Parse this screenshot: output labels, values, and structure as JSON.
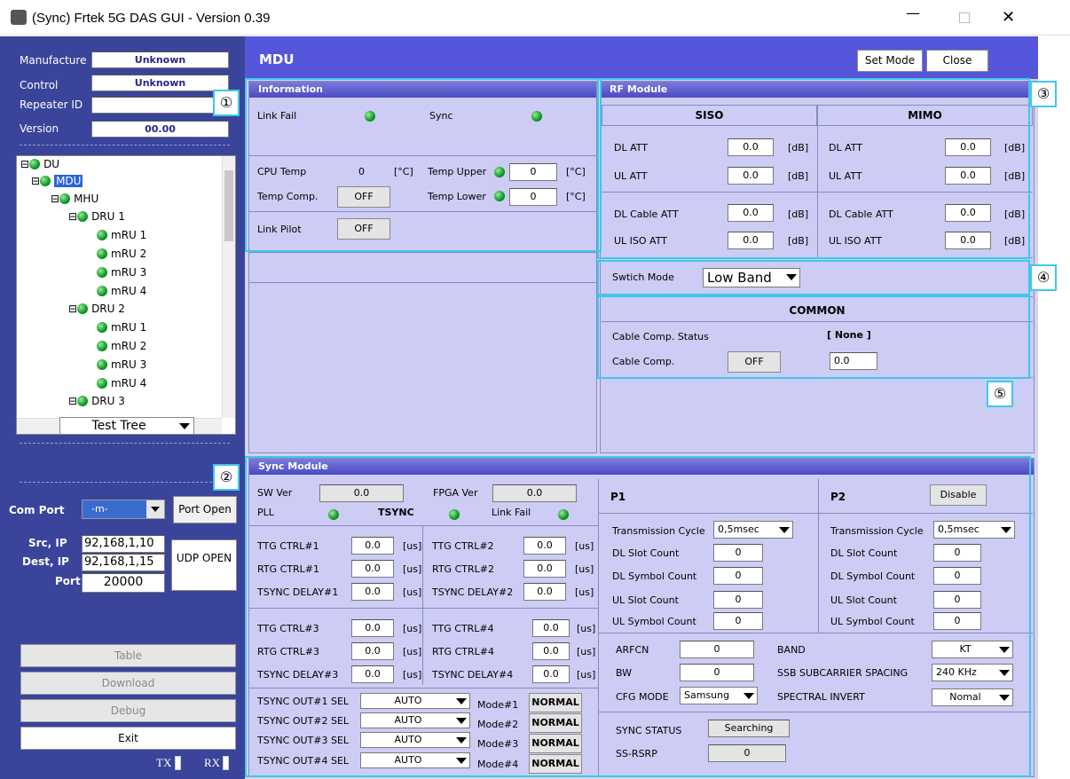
{
  "window": {
    "title": "(Sync) Frtek 5G DAS GUI - Version 0.39"
  },
  "sidebar": {
    "manufacture_label": "Manufacture",
    "manufacture_value": "Unknown",
    "control_label": "Control",
    "control_value": "Unknown",
    "repeater_label": "Repeater ID",
    "repeater_value": "",
    "version_label": "Version",
    "version_value": "00.00",
    "tree": [
      "DU",
      "MDU",
      "MHU",
      "DRU 1",
      "mRU 1",
      "mRU 2",
      "mRU 3",
      "mRU 4",
      "DRU 2",
      "mRU 1",
      "mRU 2",
      "mRU 3",
      "mRU 4",
      "DRU 3"
    ],
    "tree_select": "Test Tree",
    "com_port_label": "Com Port",
    "com_port_value": "-m-",
    "port_open": "Port Open",
    "src_ip_label": "Src, IP",
    "src_ip_value": "92,168,1,10",
    "dest_ip_label": "Dest, IP",
    "dest_ip_value": "92,168,1,15",
    "port_label": "Port",
    "port_value": "20000",
    "udp_open": "UDP OPEN",
    "table": "Table",
    "download": "Download",
    "debug": "Debug",
    "exit": "Exit",
    "tx": "TX",
    "rx": "RX"
  },
  "header": {
    "title": "MDU",
    "set_mode": "Set Mode",
    "close": "Close"
  },
  "callouts": [
    "①",
    "②",
    "③",
    "④",
    "⑤"
  ],
  "information": {
    "title": "Information",
    "link_fail": "Link Fail",
    "sync": "Sync",
    "cpu_temp": "CPU Temp",
    "cpu_temp_value": "0",
    "unit_c": "[°C]",
    "temp_upper": "Temp Upper",
    "temp_upper_value": "0",
    "temp_comp": "Temp Comp.",
    "temp_comp_btn": "OFF",
    "temp_lower": "Temp Lower",
    "temp_lower_value": "0",
    "link_pilot": "Link Pilot",
    "link_pilot_btn": "OFF"
  },
  "rf": {
    "title": "RF Module",
    "siso": "SISO",
    "mimo": "MIMO",
    "dl_att": "DL ATT",
    "ul_att": "UL ATT",
    "dl_cable_att": "DL Cable ATT",
    "ul_iso_att": "UL ISO ATT",
    "value": "0.0",
    "unit": "[dB]"
  },
  "switch": {
    "label": "Swtich Mode",
    "value": "Low Band"
  },
  "common": {
    "title": "COMMON",
    "cable_comp_status": "Cable Comp. Status",
    "status_value": "[ None ]",
    "cable_comp": "Cable Comp.",
    "btn": "OFF",
    "value": "0.0"
  },
  "sync": {
    "title": "Sync Module",
    "sw_ver": "SW Ver",
    "sw_ver_value": "0.0",
    "fpga_ver": "FPGA Ver",
    "fpga_ver_value": "0.0",
    "pll": "PLL",
    "tsync": "TSYNC",
    "link_fail": "Link Fail",
    "ttg1": "TTG CTRL#1",
    "rtg1": "RTG CTRL#1",
    "td1": "TSYNC DELAY#1",
    "ttg2": "TTG CTRL#2",
    "rtg2": "RTG CTRL#2",
    "td2": "TSYNC DELAY#2",
    "ttg3": "TTG CTRL#3",
    "rtg3": "RTG CTRL#3",
    "td3": "TSYNC DELAY#3",
    "ttg4": "TTG CTRL#4",
    "rtg4": "RTG CTRL#4",
    "td4": "TSYNC DELAY#4",
    "value": "0.0",
    "unit": "[us]",
    "out1": "TSYNC OUT#1 SEL",
    "out2": "TSYNC OUT#2 SEL",
    "out3": "TSYNC OUT#3 SEL",
    "out4": "TSYNC OUT#4 SEL",
    "auto": "AUTO",
    "mode1": "Mode#1",
    "mode2": "Mode#2",
    "mode3": "Mode#3",
    "mode4": "Mode#4",
    "normal": "NORMAL",
    "p1": "P1",
    "p2": "P2",
    "disable": "Disable",
    "tx_cycle": "Transmission Cycle",
    "tx_cycle_value": "0,5msec",
    "dl_slot": "DL Slot Count",
    "dl_symbol": "DL Symbol Count",
    "ul_slot": "UL Slot Count",
    "ul_symbol": "UL Symbol Count",
    "zero": "0",
    "arfcn": "ARFCN",
    "bw": "BW",
    "cfg_mode": "CFG MODE",
    "cfg_mode_value": "Samsung",
    "band": "BAND",
    "band_value": "KT",
    "ssb": "SSB SUBCARRIER SPACING",
    "ssb_value": "240 KHz",
    "spectral": "SPECTRAL INVERT",
    "spectral_value": "Nomal",
    "sync_status": "SYNC STATUS",
    "sync_status_value": "Searching",
    "ss_rsrp": "SS-RSRP"
  }
}
